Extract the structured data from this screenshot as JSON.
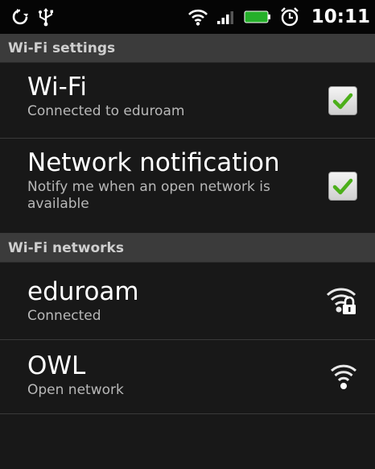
{
  "status_bar": {
    "left_icons": [
      "sync-icon",
      "usb-icon"
    ],
    "right_icons": [
      "wifi-signal-icon",
      "cell-signal-icon",
      "battery-icon",
      "alarm-icon"
    ],
    "time": "10:11"
  },
  "wifi_settings": {
    "header": "Wi-Fi settings",
    "wifi": {
      "title": "Wi-Fi",
      "subtitle": "Connected to eduroam",
      "checked": true
    },
    "network_notification": {
      "title": "Network notification",
      "subtitle": "Notify me when an open network is available",
      "checked": true
    }
  },
  "wifi_networks": {
    "header": "Wi-Fi networks",
    "networks": [
      {
        "name": "eduroam",
        "status": "Connected",
        "icon": "wifi-locked-icon"
      },
      {
        "name": "OWL",
        "status": "Open network",
        "icon": "wifi-open-icon"
      }
    ]
  },
  "colors": {
    "accent_check": "#4caf1a",
    "background": "#181818",
    "section_header": "#3b3b3b"
  }
}
